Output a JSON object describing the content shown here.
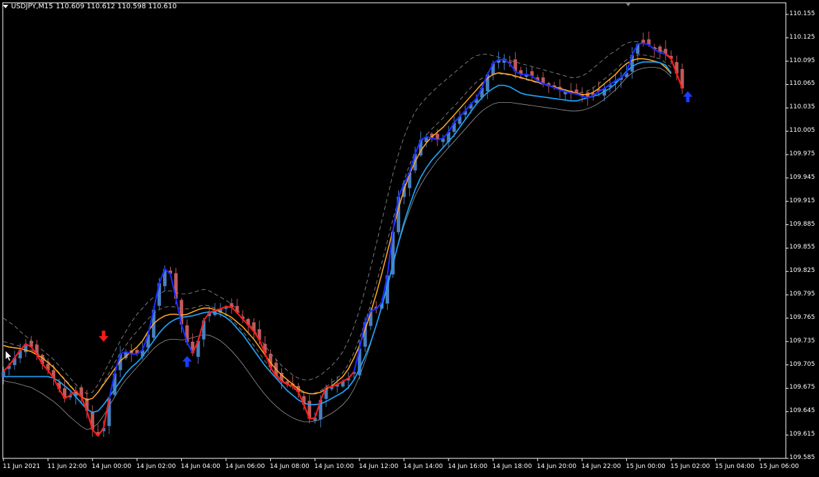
{
  "header": {
    "symbol_timeframe": "USDJPY,M15",
    "ohlc": "110.609 110.612 110.598 110.610"
  },
  "colors": {
    "background": "#000000",
    "frame": "#ffffff",
    "bull_candle": "#4a7fbf",
    "bear_candle": "#c05a5a",
    "ma_orange": "#ffa520",
    "ma_cyan": "#1e9ff0",
    "trend_blue": "#1a2cff",
    "trend_red": "#ff1a1a",
    "band": "#9a9a9a",
    "arrow_up": "#1a3cff",
    "arrow_down": "#ff1a1a"
  },
  "chart_data": {
    "type": "candlestick",
    "price_axis": {
      "ylim": [
        109.585,
        110.17
      ],
      "ticks": [
        "110.155",
        "110.125",
        "110.095",
        "110.065",
        "110.035",
        "110.005",
        "109.975",
        "109.945",
        "109.915",
        "109.885",
        "109.855",
        "109.825",
        "109.795",
        "109.765",
        "109.735",
        "109.705",
        "109.675",
        "109.645",
        "109.615",
        "109.585"
      ]
    },
    "time_axis": {
      "labels": [
        "11 Jun 2021",
        "11 Jun 22:00",
        "14 Jun 00:00",
        "14 Jun 02:00",
        "14 Jun 04:00",
        "14 Jun 06:00",
        "14 Jun 08:00",
        "14 Jun 10:00",
        "14 Jun 12:00",
        "14 Jun 14:00",
        "14 Jun 16:00",
        "14 Jun 18:00",
        "14 Jun 20:00",
        "14 Jun 22:00",
        "15 Jun 00:00",
        "15 Jun 02:00",
        "15 Jun 04:00",
        "15 Jun 06:00"
      ],
      "bars_per_label": 8
    },
    "trend_line": [
      109.697,
      109.704,
      109.714,
      109.724,
      109.732,
      109.728,
      109.718,
      109.706,
      109.698,
      109.688,
      109.674,
      109.662,
      109.666,
      109.672,
      109.664,
      109.646,
      109.622,
      109.614,
      109.624,
      109.662,
      109.694,
      109.719,
      109.722,
      109.719,
      109.719,
      109.724,
      109.744,
      109.776,
      109.81,
      109.828,
      109.822,
      109.79,
      109.757,
      109.734,
      109.72,
      109.736,
      109.762,
      109.772,
      109.775,
      109.777,
      109.78,
      109.779,
      109.772,
      109.764,
      109.756,
      109.748,
      109.737,
      109.72,
      109.702,
      109.69,
      109.684,
      109.68,
      109.678,
      109.67,
      109.654,
      109.636,
      109.637,
      109.66,
      109.676,
      109.677,
      109.68,
      109.684,
      109.688,
      109.696,
      109.726,
      109.76,
      109.774,
      109.777,
      109.785,
      109.82,
      109.876,
      109.921,
      109.938,
      109.952,
      109.976,
      109.994,
      109.998,
      109.996,
      109.994,
      109.996,
      110.004,
      110.016,
      110.024,
      110.031,
      110.04,
      110.047,
      110.061,
      110.078,
      110.092,
      110.097,
      110.097,
      110.092,
      110.082,
      110.078,
      110.078,
      110.076,
      110.07,
      110.066,
      110.064,
      110.061,
      110.058,
      110.056,
      110.054,
      110.053,
      110.05,
      110.048,
      110.051,
      110.056,
      110.06,
      110.065,
      110.07,
      110.074,
      110.08,
      110.103,
      110.117,
      110.118,
      110.116,
      110.11,
      110.106,
      110.104,
      110.098,
      110.079,
      110.06
    ],
    "trend_colors": [
      "red",
      "red",
      "red",
      "red",
      "red",
      "red",
      "red",
      "red",
      "red",
      "red",
      "red",
      "red",
      "red",
      "red",
      "red",
      "red",
      "red",
      "red",
      "red",
      "blue",
      "blue",
      "blue",
      "blue",
      "blue",
      "blue",
      "blue",
      "blue",
      "blue",
      "blue",
      "blue",
      "blue",
      "blue",
      "blue",
      "blue",
      "red",
      "red",
      "red",
      "red",
      "red",
      "red",
      "red",
      "red",
      "red",
      "red",
      "red",
      "red",
      "red",
      "red",
      "red",
      "red",
      "red",
      "red",
      "red",
      "red",
      "red",
      "red",
      "red",
      "red",
      "red",
      "red",
      "red",
      "red",
      "red",
      "blue",
      "blue",
      "blue",
      "blue",
      "blue",
      "blue",
      "blue",
      "blue",
      "blue",
      "blue",
      "blue",
      "blue",
      "blue",
      "blue",
      "blue",
      "blue",
      "blue",
      "blue",
      "blue",
      "blue",
      "blue",
      "blue",
      "blue",
      "blue",
      "blue",
      "blue",
      "blue",
      "blue",
      "blue",
      "blue",
      "blue",
      "blue",
      "blue",
      "blue",
      "blue",
      "blue",
      "blue",
      "blue",
      "blue",
      "blue",
      "blue",
      "blue",
      "blue",
      "blue",
      "blue",
      "blue",
      "blue",
      "blue",
      "blue",
      "blue",
      "blue",
      "blue",
      "blue",
      "blue",
      "blue",
      "blue",
      "red",
      "red"
    ],
    "ma_orange": [
      109.73,
      109.728,
      109.727,
      109.726,
      109.724,
      109.722,
      109.718,
      109.714,
      109.708,
      109.702,
      109.694,
      109.686,
      109.678,
      109.67,
      109.664,
      109.66,
      109.662,
      109.67,
      109.68,
      109.69,
      109.7,
      109.71,
      109.716,
      109.722,
      109.728,
      109.736,
      109.748,
      109.758,
      109.764,
      109.768,
      109.77,
      109.77,
      109.769,
      109.77,
      109.773,
      109.776,
      109.778,
      109.778,
      109.776,
      109.773,
      109.77,
      109.766,
      109.76,
      109.754,
      109.746,
      109.738,
      109.728,
      109.718,
      109.708,
      109.699,
      109.692,
      109.686,
      109.68,
      109.674,
      109.67,
      109.668,
      109.668,
      109.67,
      109.674,
      109.678,
      109.684,
      109.69,
      109.7,
      109.714,
      109.73,
      109.75,
      109.772,
      109.796,
      109.822,
      109.85,
      109.878,
      109.906,
      109.93,
      109.95,
      109.966,
      109.98,
      109.99,
      109.998,
      110.004,
      110.01,
      110.018,
      110.026,
      110.034,
      110.042,
      110.05,
      110.058,
      110.066,
      110.073,
      110.078,
      110.08,
      110.079,
      110.078,
      110.076,
      110.074,
      110.072,
      110.07,
      110.068,
      110.066,
      110.064,
      110.062,
      110.06,
      110.058,
      110.056,
      110.054,
      110.052,
      110.052,
      110.055,
      110.06,
      110.066,
      110.072,
      110.078,
      110.086,
      110.092,
      110.096,
      110.098,
      110.098,
      110.097,
      110.095,
      110.093,
      110.087,
      110.079
    ],
    "ma_cyan": [
      109.69,
      109.69,
      109.69,
      109.69,
      109.69,
      109.69,
      109.69,
      109.69,
      109.69,
      109.688,
      109.684,
      109.678,
      109.672,
      109.664,
      109.656,
      109.648,
      109.644,
      109.646,
      109.654,
      109.664,
      109.674,
      109.684,
      109.694,
      109.702,
      109.708,
      109.716,
      109.726,
      109.736,
      109.746,
      109.754,
      109.76,
      109.764,
      109.766,
      109.767,
      109.768,
      109.77,
      109.772,
      109.773,
      109.772,
      109.77,
      109.766,
      109.76,
      109.752,
      109.744,
      109.734,
      109.724,
      109.714,
      109.704,
      109.696,
      109.688,
      109.68,
      109.672,
      109.666,
      109.66,
      109.656,
      109.654,
      109.654,
      109.655,
      109.658,
      109.662,
      109.666,
      109.67,
      109.676,
      109.686,
      109.7,
      109.716,
      109.734,
      109.756,
      109.78,
      109.806,
      109.834,
      109.862,
      109.888,
      109.91,
      109.93,
      109.946,
      109.958,
      109.968,
      109.976,
      109.984,
      109.992,
      110.0,
      110.01,
      110.02,
      110.03,
      110.04,
      110.048,
      110.055,
      110.06,
      110.064,
      110.064,
      110.062,
      110.058,
      110.054,
      110.052,
      110.051,
      110.05,
      110.049,
      110.048,
      110.047,
      110.046,
      110.045,
      110.044,
      110.044,
      110.046,
      110.048,
      110.05,
      110.052,
      110.056,
      110.06,
      110.066,
      110.074,
      110.082,
      110.088,
      110.092,
      110.094,
      110.094,
      110.094,
      110.093,
      110.09,
      110.08
    ],
    "band_upper": [
      109.765,
      109.76,
      109.755,
      109.748,
      109.742,
      109.736,
      109.73,
      109.724,
      109.718,
      109.712,
      109.704,
      109.696,
      109.688,
      109.68,
      109.672,
      109.668,
      109.67,
      109.68,
      109.694,
      109.708,
      109.722,
      109.736,
      109.748,
      109.76,
      109.77,
      109.778,
      109.786,
      109.792,
      109.796,
      109.8,
      109.8,
      109.798,
      109.796,
      109.796,
      109.798,
      109.8,
      109.802,
      109.8,
      109.796,
      109.792,
      109.788,
      109.783,
      109.776,
      109.768,
      109.759,
      109.75,
      109.74,
      109.73,
      109.72,
      109.712,
      109.704,
      109.698,
      109.692,
      109.688,
      109.686,
      109.686,
      109.688,
      109.692,
      109.698,
      109.704,
      109.712,
      109.722,
      109.736,
      109.754,
      109.776,
      109.802,
      109.83,
      109.86,
      109.89,
      109.92,
      109.95,
      109.976,
      109.998,
      110.016,
      110.03,
      110.04,
      110.048,
      110.055,
      110.062,
      110.068,
      110.074,
      110.08,
      110.086,
      110.092,
      110.098,
      110.102,
      110.104,
      110.104,
      110.102,
      110.1,
      110.098,
      110.096,
      110.094,
      110.092,
      110.09,
      110.088,
      110.086,
      110.084,
      110.082,
      110.08,
      110.078,
      110.076,
      110.074,
      110.074,
      110.076,
      110.08,
      110.086,
      110.092,
      110.098,
      110.104,
      110.108,
      110.114,
      110.118,
      110.12,
      110.12,
      110.118,
      110.116,
      110.112,
      110.11,
      110.105,
      110.1
    ],
    "band_mid": [
      109.735,
      109.733,
      109.731,
      109.729,
      109.727,
      109.724,
      109.72,
      109.716,
      109.71,
      109.703,
      109.695,
      109.687,
      109.679,
      109.671,
      109.664,
      109.66,
      109.662,
      109.67,
      109.682,
      109.695,
      109.708,
      109.72,
      109.73,
      109.74,
      109.748,
      109.756,
      109.764,
      109.771,
      109.776,
      109.779,
      109.78,
      109.779,
      109.777,
      109.777,
      109.778,
      109.78,
      109.782,
      109.781,
      109.778,
      109.774,
      109.769,
      109.763,
      109.756,
      109.748,
      109.739,
      109.73,
      109.72,
      109.71,
      109.701,
      109.693,
      109.686,
      109.68,
      109.675,
      109.671,
      109.669,
      109.668,
      109.669,
      109.672,
      109.677,
      109.682,
      109.688,
      109.695,
      109.706,
      109.721,
      109.739,
      109.76,
      109.783,
      109.809,
      109.836,
      109.864,
      109.892,
      109.918,
      109.942,
      109.962,
      109.978,
      109.991,
      110.0,
      110.008,
      110.015,
      110.022,
      110.03,
      110.037,
      110.045,
      110.053,
      110.061,
      110.068,
      110.073,
      110.076,
      110.078,
      110.079,
      110.078,
      110.077,
      110.075,
      110.073,
      110.071,
      110.069,
      110.067,
      110.065,
      110.063,
      110.061,
      110.059,
      110.057,
      110.055,
      110.054,
      110.055,
      110.057,
      110.061,
      110.066,
      110.072,
      110.078,
      110.084,
      110.091,
      110.097,
      110.101,
      110.103,
      110.103,
      110.102,
      110.1,
      110.098,
      110.093,
      110.087
    ],
    "band_lower": [
      109.685,
      109.683,
      109.682,
      109.68,
      109.678,
      109.676,
      109.672,
      109.668,
      109.663,
      109.658,
      109.652,
      109.645,
      109.638,
      109.632,
      109.626,
      109.622,
      109.624,
      109.63,
      109.64,
      109.652,
      109.664,
      109.676,
      109.686,
      109.694,
      109.702,
      109.71,
      109.718,
      109.726,
      109.732,
      109.736,
      109.738,
      109.738,
      109.737,
      109.738,
      109.74,
      109.742,
      109.744,
      109.743,
      109.74,
      109.736,
      109.73,
      109.723,
      109.715,
      109.706,
      109.696,
      109.686,
      109.676,
      109.667,
      109.659,
      109.652,
      109.646,
      109.641,
      109.637,
      109.634,
      109.632,
      109.632,
      109.633,
      109.635,
      109.639,
      109.643,
      109.648,
      109.654,
      109.662,
      109.674,
      109.69,
      109.71,
      109.732,
      109.756,
      109.782,
      109.808,
      109.834,
      109.86,
      109.884,
      109.904,
      109.922,
      109.936,
      109.948,
      109.958,
      109.968,
      109.976,
      109.984,
      109.992,
      110.0,
      110.008,
      110.016,
      110.024,
      110.031,
      110.036,
      110.04,
      110.042,
      110.042,
      110.042,
      110.041,
      110.04,
      110.039,
      110.038,
      110.037,
      110.036,
      110.035,
      110.034,
      110.033,
      110.032,
      110.031,
      110.031,
      110.032,
      110.034,
      110.037,
      110.041,
      110.046,
      110.052,
      110.058,
      110.066,
      110.074,
      110.08,
      110.084,
      110.086,
      110.087,
      110.087,
      110.086,
      110.082,
      110.075
    ],
    "signals": [
      {
        "type": "sell",
        "bar": 18,
        "price": 109.733
      },
      {
        "type": "buy",
        "bar": 33,
        "price": 109.72
      },
      {
        "type": "buy",
        "bar": 123,
        "price": 110.06
      }
    ]
  }
}
